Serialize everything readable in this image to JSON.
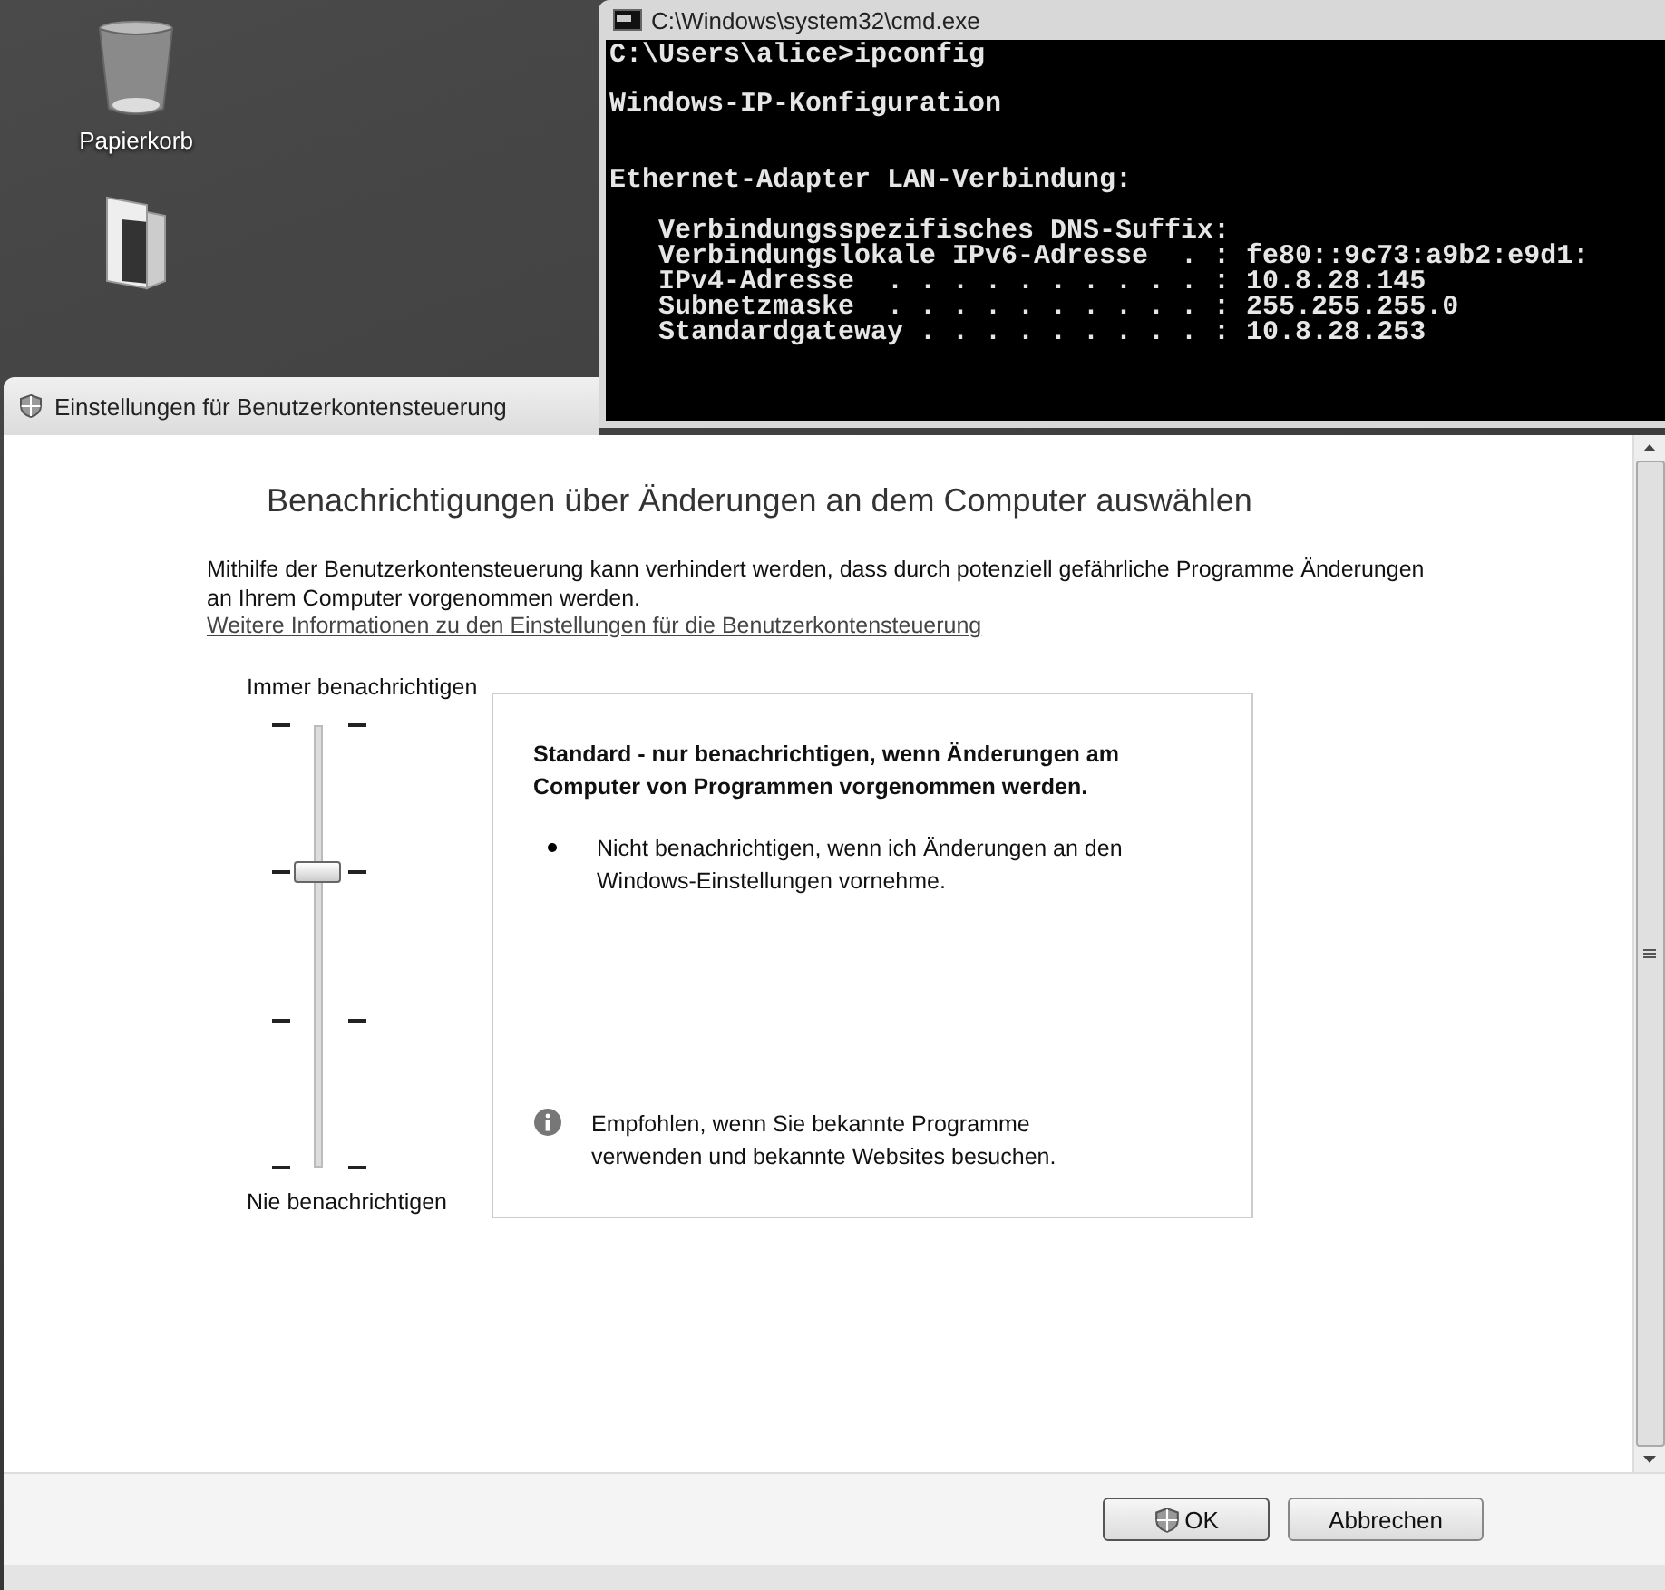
{
  "desktop": {
    "icons": [
      {
        "kind": "trash",
        "label": "Papierkorb"
      },
      {
        "kind": "folder"
      }
    ]
  },
  "console_window": {
    "title": "C:\\Windows\\system32\\cmd.exe",
    "lines": [
      {
        "kind": "command",
        "text": "C:\\Users\\alice>ipconfig"
      },
      {
        "kind": "title",
        "text": "Windows-IP-Konfiguration"
      },
      {
        "kind": "section",
        "text": "Ethernet-Adapter LAN-Verbindung:"
      },
      {
        "kind": "first_detail",
        "text": "Verbindungsspezifisches DNS-Suffix:"
      },
      {
        "kind": "detail",
        "text": "Verbindungslokale IPv6-Adresse  . : fe80::9c73:a9b2:e9d1:"
      },
      {
        "kind": "detail",
        "text": "IPv4-Adresse  . . . . . . . . . . : 10.8.28.145"
      },
      {
        "kind": "detail",
        "text": "Subnetzmaske  . . . . . . . . . . : 255.255.255.0"
      },
      {
        "kind": "detail",
        "text": "Standardgateway . . . . . . . . . : 10.8.28.253"
      }
    ]
  },
  "dialog": {
    "title": "Einstellungen für Benutzerkontensteuerung",
    "heading": "Benachrichtigungen über Änderungen an dem Computer auswählen",
    "description": "Mithilfe der Benutzerkontensteuerung kann verhindert werden, dass durch potenziell gefährliche Programme Änderungen an Ihrem Computer vorgenommen werden.",
    "link": "Weitere Informationen zu den Einstellungen für die Benutzerkontensteuerung",
    "slider": {
      "top_label": "Immer benachrichtigen",
      "bottom_label": "Nie benachrichtigen",
      "level": 0.667
    },
    "info_box": {
      "title": "Standard - nur benachrichtigen, wenn Änderungen am Computer von Programmen vorgenommen werden.",
      "bullets": [
        "Nicht benachrichtigen, wenn ich Änderungen an den Windows-Einstellungen vornehme."
      ],
      "note": "Empfohlen, wenn Sie bekannte Programme verwenden und bekannte Websites besuchen."
    },
    "buttons": [
      {
        "kind": "shield",
        "label": "OK"
      },
      {
        "kind": "plain",
        "label": "Abbrechen"
      }
    ]
  }
}
